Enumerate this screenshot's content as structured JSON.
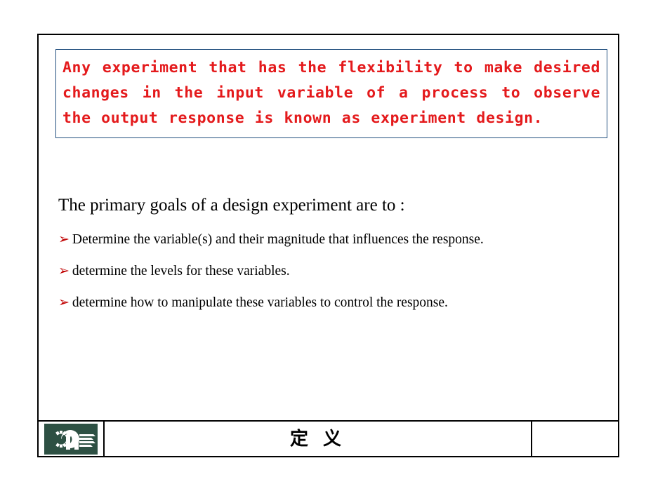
{
  "slide": {
    "callout": {
      "text": "Any experiment that has the flexibility to make desired changes in the input variable of a process to observe the output response is known as experiment design.",
      "border_color": "#23507f",
      "text_color": "#e41a1c"
    },
    "heading": "The primary goals of a design experiment are to :",
    "bullet_marker": "➢",
    "bullet_marker_color": "#c00000",
    "bullets": [
      "Determine the variable(s) and their magnitude that influences the response.",
      "determine the levels  for these variables.",
      "determine how to manipulate these variables to control the response."
    ],
    "footer": {
      "logo_alt": "university-emblem",
      "logo_background": "#2d5043",
      "logo_foreground": "#ffffff",
      "title": "定 义",
      "right_cell": ""
    },
    "border_color": "#000000"
  }
}
